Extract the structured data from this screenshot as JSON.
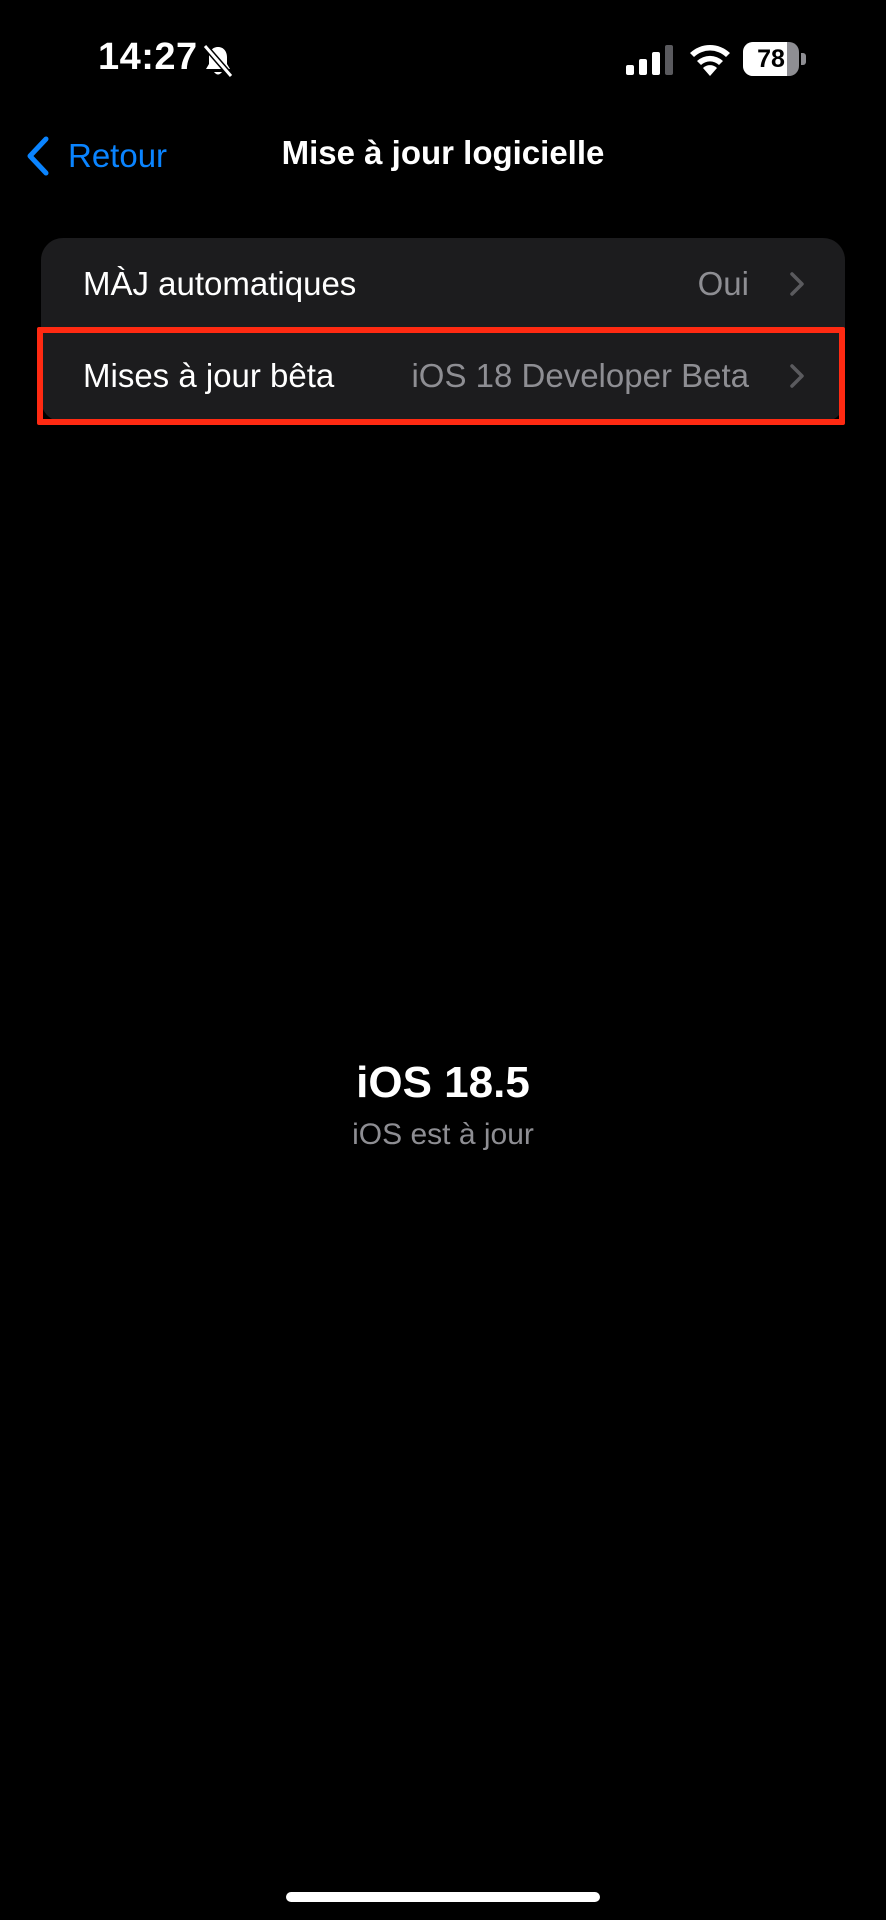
{
  "status_bar": {
    "time": "14:27",
    "battery_level": "78",
    "icons": [
      "bell-slash-icon",
      "cellular-signal-icon",
      "wifi-icon",
      "battery-icon"
    ]
  },
  "nav": {
    "back_label": "Retour",
    "title": "Mise à jour logicielle"
  },
  "settings": {
    "rows": [
      {
        "label": "MÀJ automatiques",
        "value": "Oui"
      },
      {
        "label": "Mises à jour bêta",
        "value": "iOS 18 Developer Beta",
        "highlighted": true
      }
    ]
  },
  "software": {
    "version": "iOS 18.5",
    "status": "iOS est à jour"
  },
  "colors": {
    "background": "#000000",
    "group_background": "#1c1c1e",
    "accent": "#0a84ff",
    "secondary_text": "#8e8e93",
    "highlight": "#ff2a12"
  }
}
